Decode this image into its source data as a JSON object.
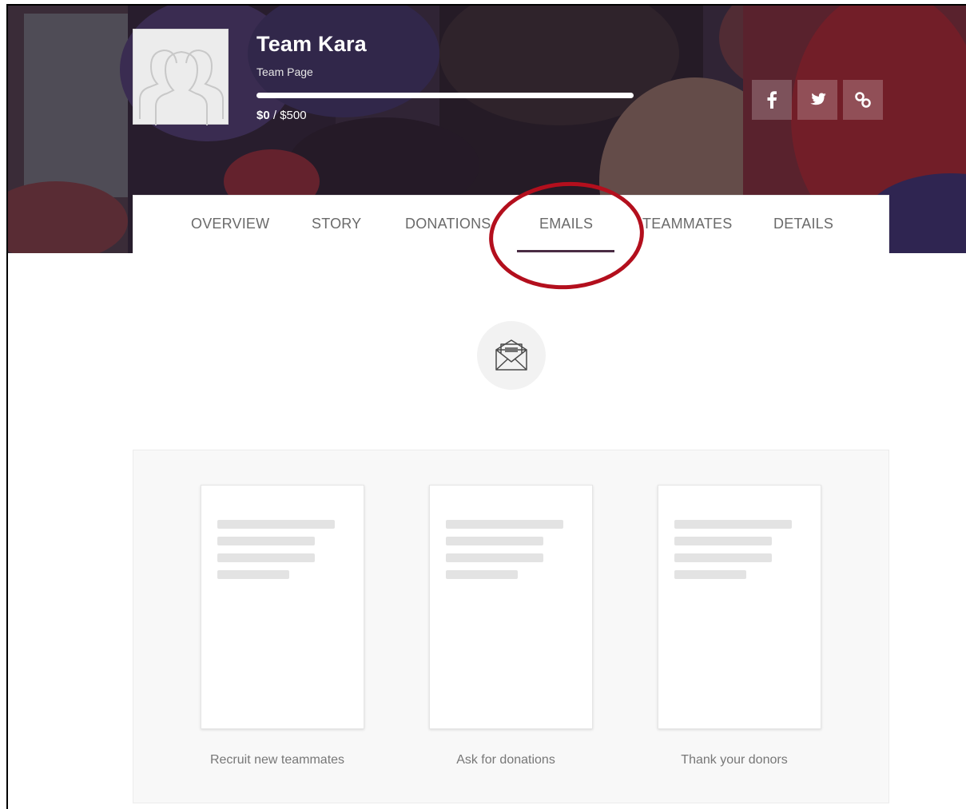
{
  "team": {
    "name": "Team Kara",
    "subtitle": "Team Page",
    "raised": "$0",
    "goal": "$500",
    "progress": 0
  },
  "social": [
    {
      "icon": "facebook-icon",
      "glyph": "f"
    },
    {
      "icon": "twitter-icon",
      "glyph": ""
    },
    {
      "icon": "link-icon",
      "glyph": ""
    }
  ],
  "tabs": [
    {
      "label": "OVERVIEW"
    },
    {
      "label": "STORY"
    },
    {
      "label": "DONATIONS"
    },
    {
      "label": "EMAILS",
      "active": true
    },
    {
      "label": "TEAMMATES"
    },
    {
      "label": "DETAILS"
    }
  ],
  "emails": {
    "icon": "envelope-icon",
    "templates": [
      {
        "label": "Recruit new teammates"
      },
      {
        "label": "Ask for donations"
      },
      {
        "label": "Thank your donors"
      }
    ]
  },
  "colors": {
    "accent": "#4a2c44",
    "highlight_ring": "#b30f1d"
  }
}
